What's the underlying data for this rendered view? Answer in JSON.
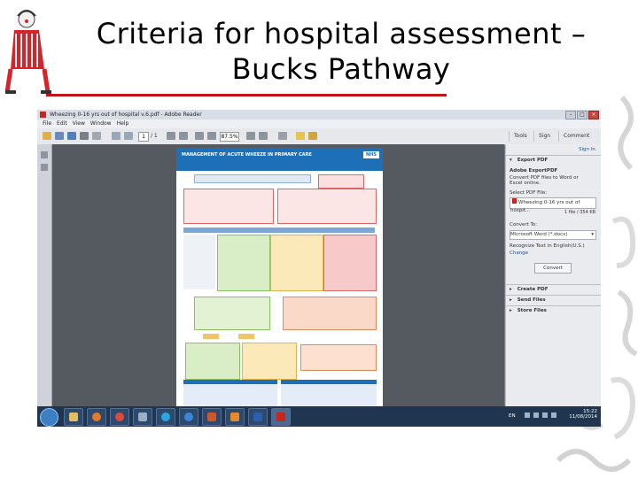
{
  "slide": {
    "title_line1": "Criteria for hospital assessment –",
    "title_line2": "Bucks Pathway",
    "rule_color": "#c0141a"
  },
  "screenshot": {
    "window_title": "Wheezing 0-16 yrs out of hospital v.6.pdf - Adobe Reader",
    "menu": [
      "File",
      "Edit",
      "View",
      "Window",
      "Help"
    ],
    "toolbar": {
      "page_current": "1",
      "page_total": "/ 1",
      "zoom": "87.5%",
      "tabs": [
        "Tools",
        "Sign",
        "Comment"
      ]
    },
    "document": {
      "header": "MANAGEMENT OF ACUTE WHEEZE IN PRIMARY CARE",
      "badge": "NHS"
    },
    "right_pane": {
      "sign_in": "Sign In",
      "export_header": "Export PDF",
      "adobe_title": "Adobe ExportPDF",
      "adobe_desc": "Convert PDF files to Word or Excel online.",
      "select_label": "Select PDF File:",
      "file_name": "Wheezing 0-16 yrs out of hospit...",
      "file_count": "1 file / 354 KB",
      "convert_to_label": "Convert To:",
      "convert_to_value": "Microsoft Word (*.docx)",
      "recognize_text": "Recognize Text in English(U.S.)",
      "change_link": "Change",
      "convert_button": "Convert",
      "sections": [
        "Create PDF",
        "Send Files",
        "Store Files"
      ]
    },
    "taskbar": {
      "lang": "EN",
      "time": "15:22",
      "date": "11/08/2014"
    }
  }
}
